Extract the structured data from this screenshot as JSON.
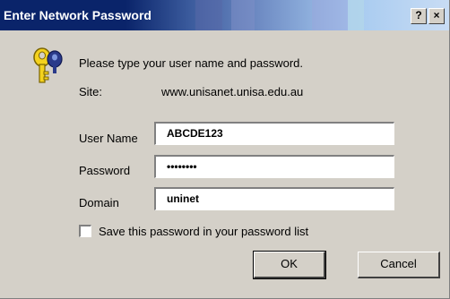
{
  "window": {
    "title": "Enter Network Password",
    "help_label": "?",
    "close_label": "×"
  },
  "prompt": "Please type your user name and password.",
  "site": {
    "label": "Site:",
    "value": "www.unisanet.unisa.edu.au"
  },
  "fields": {
    "username": {
      "label": "User Name",
      "value": "ABCDE123"
    },
    "password": {
      "label": "Password",
      "value": "••••••••"
    },
    "domain": {
      "label": "Domain",
      "value": "uninet"
    }
  },
  "save_password": {
    "label": "Save this password in your password list",
    "checked": false
  },
  "buttons": {
    "ok": "OK",
    "cancel": "Cancel"
  },
  "icons": {
    "dialog_icon": "key-icon"
  },
  "colors": {
    "titlebar_active": "#0a246a",
    "dialog_face": "#d4d0c8"
  }
}
